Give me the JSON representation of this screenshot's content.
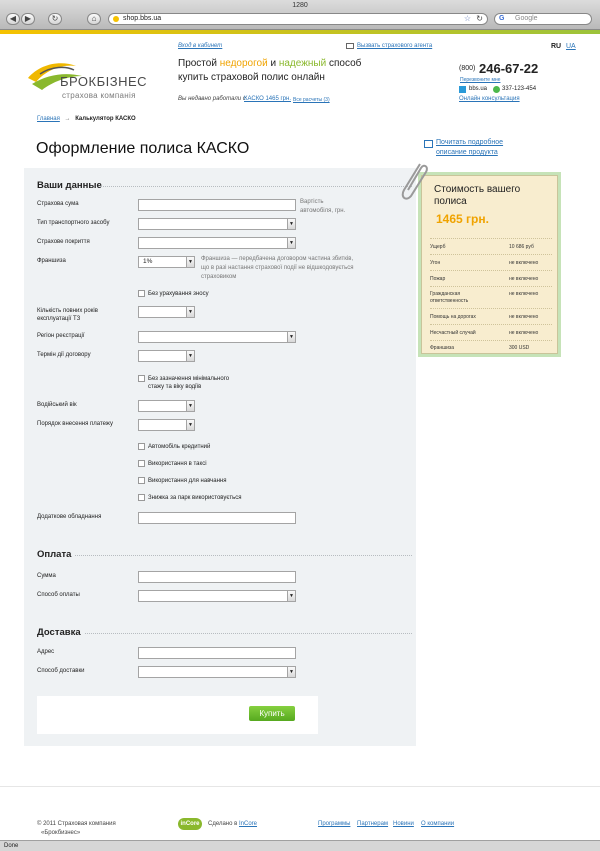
{
  "browser": {
    "title": "1280",
    "back": "◀",
    "forward": "▶",
    "reload": "↻",
    "home": "⌂",
    "rss": "+",
    "url": "shop.bbs.ua",
    "search_placeholder": "Google",
    "status": "Done"
  },
  "header": {
    "logo_title": "БРОКБІЗНЕС",
    "logo_sub": "страхова компанія",
    "cabinet_link": "Вход в кабинет",
    "slogan_1": "Простой ",
    "slogan_2": "недорогой",
    "slogan_3": " и ",
    "slogan_4": "надежный",
    "slogan_5": " способ",
    "slogan_line2": "купить страховой полис онлайн",
    "call_agent": "Вызвать страхового агента",
    "recent_label": "Вы недавно работали с",
    "recent_link": "КАСКО 1465 грн.",
    "recent_all": "Все расчеты (3)",
    "lang_ru": "RU",
    "lang_ua": "UA",
    "phone_code": "(800)",
    "phone_number": "246-67-22",
    "callback": "Перезвоните мне",
    "skype": "bbs.ua",
    "icq": "337-123-454",
    "consult": "Онлайн консультация"
  },
  "breadcrumb": {
    "home": "Главная",
    "arrow": "→",
    "current": "Калькулятор КАСКО"
  },
  "page_title": "Оформление полиса КАСКО",
  "product_link_1": "Почитать подробное",
  "product_link_2": "описание продукта",
  "form": {
    "section_data": "Ваши данные",
    "sum_label": "Страхова сума",
    "sum_hint_1": "Вартість",
    "sum_hint_2": "автомобіля, грн.",
    "vehicle_type_label": "Тип транспортного засобу",
    "coverage_label": "Страхове покриття",
    "franchise_label": "Франшиза",
    "franchise_value": "1%",
    "franchise_hint_1": "Франшиза — передбачена договором частина збитків,",
    "franchise_hint_2": "що в разі настання страхової події не відшкодовується",
    "franchise_hint_3": "страховиком",
    "no_wear": "Без урахування зносу",
    "years_label_1": "Кількість повних років",
    "years_label_2": "експлуатації ТЗ",
    "region_label": "Регіон реєстрації",
    "term_label": "Термін дії договору",
    "no_min_1": "Без зазначення мінімального",
    "no_min_2": "стажу та віку водіїв",
    "driver_age_label": "Водійський вік",
    "payment_order_label": "Порядок внесення платежу",
    "credit_car": "Автомобіль кредитний",
    "taxi_use": "Використання в таксі",
    "training_use": "Використання для навчання",
    "fleet_discount": "Знижка за парк використовується",
    "extra_equipment_label": "Додаткове обладнання",
    "section_payment": "Оплата",
    "amount_label": "Сумма",
    "payment_method_label": "Способ оплаты",
    "section_delivery": "Доставка",
    "address_label": "Адрес",
    "delivery_method_label": "Способ доставки",
    "buy_button": "Купить"
  },
  "price": {
    "title_1": "Стоимость вашего",
    "title_2": "полиса",
    "amount": "1465 грн.",
    "rows": [
      {
        "k": "Ущерб",
        "v": "10 686 руб"
      },
      {
        "k": "Угон",
        "v": "не включено"
      },
      {
        "k": "Пожар",
        "v": "не включено"
      },
      {
        "k": "Гражданская",
        "k2": "ответственность",
        "v": "не включено"
      },
      {
        "k": "Помощь на дорогах",
        "v": "не включено"
      },
      {
        "k": "Несчастный случай",
        "v": "не включено"
      },
      {
        "k": "Франшиза",
        "v": "300 USD"
      }
    ]
  },
  "footer": {
    "copyright_1": "© 2011 Страховая компания",
    "copyright_2": "«Брокбизнес»",
    "incore_logo": "inCore",
    "made_by": "Сделано в",
    "made_by_link": "InCore",
    "links": [
      "Программы",
      "Партнерам",
      "Новини",
      "О компании"
    ]
  },
  "colors": {
    "accent_orange": "#f0a300",
    "accent_green": "#8ab82d",
    "link": "#2a74b8",
    "button": "#6cbf2e"
  }
}
